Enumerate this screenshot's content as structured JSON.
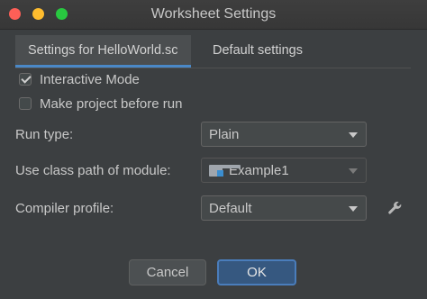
{
  "window": {
    "title": "Worksheet Settings"
  },
  "tabs": [
    {
      "label": "Settings for HelloWorld.sc",
      "active": true
    },
    {
      "label": "Default settings",
      "active": false
    }
  ],
  "options": {
    "interactive_mode": {
      "label": "Interactive Mode",
      "checked": true
    },
    "make_project": {
      "label": "Make project before run",
      "checked": false
    }
  },
  "fields": {
    "run_type": {
      "label": "Run type:",
      "value": "Plain"
    },
    "class_path": {
      "label": "Use class path of module:",
      "value": "Example1",
      "icon": "module-folder-icon"
    },
    "compiler_profile": {
      "label": "Compiler profile:",
      "value": "Default",
      "icon": "wrench-icon"
    }
  },
  "buttons": {
    "cancel": "Cancel",
    "ok": "OK"
  },
  "colors": {
    "background": "#3c3f41",
    "accent": "#4a88c7",
    "ok_button": "#365880"
  }
}
